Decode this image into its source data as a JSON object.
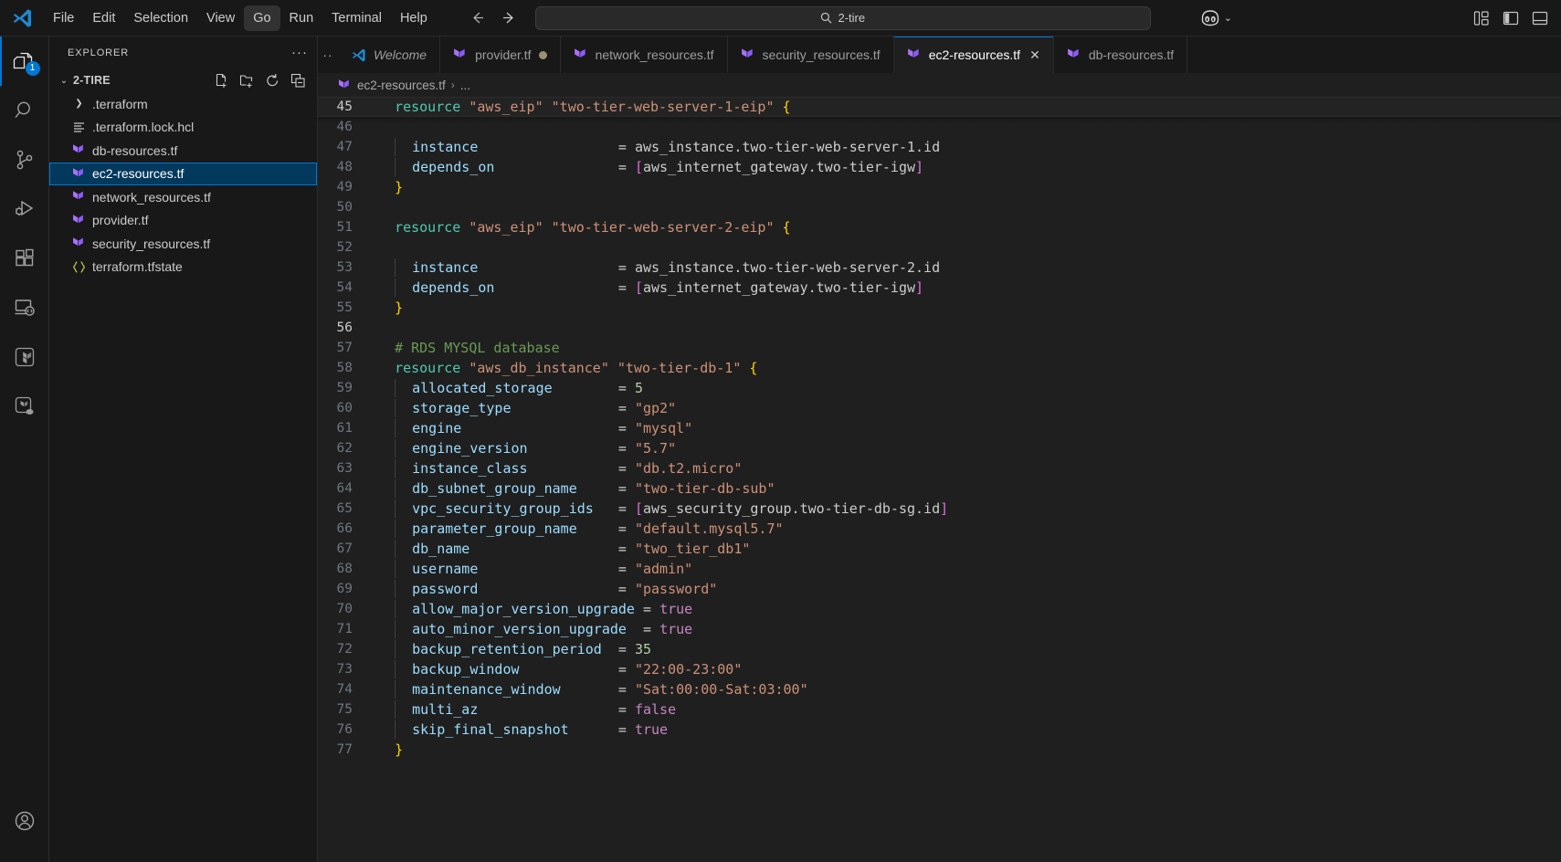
{
  "titlebar": {
    "logo_icon": "vscode-logo-icon",
    "menus": [
      {
        "label": "File",
        "active": false
      },
      {
        "label": "Edit",
        "active": false
      },
      {
        "label": "Selection",
        "active": false
      },
      {
        "label": "View",
        "active": false
      },
      {
        "label": "Go",
        "active": true
      },
      {
        "label": "Run",
        "active": false
      },
      {
        "label": "Terminal",
        "active": false
      },
      {
        "label": "Help",
        "active": false
      }
    ],
    "nav": {
      "back_icon": "arrow-left-icon",
      "forward_icon": "arrow-right-icon"
    },
    "search": {
      "value": "2-tire",
      "icon": "search-icon"
    },
    "copilot": {
      "icon": "copilot-icon",
      "chevron": "chevron-down-icon"
    },
    "layout": {
      "panel_icon": "customize-layout-icon",
      "sidebar_icon": "toggle-primary-sidebar-icon",
      "bottom_icon": "toggle-panel-icon"
    }
  },
  "activitybar": {
    "items": [
      {
        "name": "explorer",
        "icon": "files-icon",
        "badge": "1",
        "active": true
      },
      {
        "name": "search",
        "icon": "search-icon",
        "badge": "",
        "active": false
      },
      {
        "name": "source-control",
        "icon": "source-control-icon",
        "badge": "",
        "active": false
      },
      {
        "name": "run-and-debug",
        "icon": "run-debug-icon",
        "badge": "",
        "active": false
      },
      {
        "name": "extensions",
        "icon": "extensions-icon",
        "badge": "",
        "active": false
      },
      {
        "name": "remote-explorer",
        "icon": "remote-explorer-icon",
        "badge": "",
        "active": false
      },
      {
        "name": "terraform",
        "icon": "terraform-icon",
        "badge": "",
        "active": false
      },
      {
        "name": "terraform-cloud",
        "icon": "terraform-cloud-icon",
        "badge": "",
        "active": false
      }
    ],
    "account_icon": "account-icon"
  },
  "sidebar": {
    "title": "EXPLORER",
    "more_actions": "···",
    "root": {
      "label": "2-TIRE",
      "caret": "chevron-down-icon",
      "actions": [
        "new-file-icon",
        "new-folder-icon",
        "refresh-icon",
        "collapse-all-icon"
      ]
    },
    "items": [
      {
        "label": ".terraform",
        "icon": "folder-icon",
        "type": "folder",
        "selected": false
      },
      {
        "label": ".terraform.lock.hcl",
        "icon": "hcl-lock-icon",
        "type": "file",
        "selected": false
      },
      {
        "label": "db-resources.tf",
        "icon": "terraform-file-icon",
        "type": "file",
        "selected": false
      },
      {
        "label": "ec2-resources.tf",
        "icon": "terraform-file-icon",
        "type": "file",
        "selected": true
      },
      {
        "label": "network_resources.tf",
        "icon": "terraform-file-icon",
        "type": "file",
        "selected": false
      },
      {
        "label": "provider.tf",
        "icon": "terraform-file-icon",
        "type": "file",
        "selected": false
      },
      {
        "label": "security_resources.tf",
        "icon": "terraform-file-icon",
        "type": "file",
        "selected": false
      },
      {
        "label": "terraform.tfstate",
        "icon": "json-icon",
        "type": "file",
        "selected": false
      }
    ]
  },
  "editor": {
    "tabs": [
      {
        "label": "Welcome",
        "icon": "vscode-logo-icon",
        "italic": true,
        "active": false,
        "modified": false,
        "closable": false
      },
      {
        "label": "provider.tf",
        "icon": "terraform-file-icon",
        "italic": false,
        "active": false,
        "modified": true,
        "closable": false
      },
      {
        "label": "network_resources.tf",
        "icon": "terraform-file-icon",
        "italic": false,
        "active": false,
        "modified": false,
        "closable": false
      },
      {
        "label": "security_resources.tf",
        "icon": "terraform-file-icon",
        "italic": false,
        "active": false,
        "modified": false,
        "closable": false
      },
      {
        "label": "ec2-resources.tf",
        "icon": "terraform-file-icon",
        "italic": false,
        "active": true,
        "modified": false,
        "closable": true
      },
      {
        "label": "db-resources.tf",
        "icon": "terraform-file-icon",
        "italic": false,
        "active": false,
        "modified": false,
        "closable": false
      }
    ],
    "close_label": "✕",
    "breadcrumb": {
      "icon": "terraform-file-icon",
      "file": "ec2-resources.tf",
      "separator": "›",
      "rest": "..."
    },
    "lines": [
      {
        "num": "45",
        "sticky": true,
        "tokens": [
          {
            "t": "sp",
            "v": "  "
          },
          {
            "t": "kw",
            "v": "resource"
          },
          {
            "t": "plain",
            "v": " "
          },
          {
            "t": "str",
            "v": "\"aws_eip\""
          },
          {
            "t": "plain",
            "v": " "
          },
          {
            "t": "str",
            "v": "\"two-tier-web-server-1-eip\""
          },
          {
            "t": "plain",
            "v": " "
          },
          {
            "t": "brace-y",
            "v": "{"
          }
        ]
      },
      {
        "num": "46",
        "tokens": []
      },
      {
        "num": "47",
        "guide": true,
        "tokens": [
          {
            "t": "sp",
            "v": "    "
          },
          {
            "t": "prop",
            "v": "instance"
          },
          {
            "t": "plain",
            "v": "                 = "
          },
          {
            "t": "plain",
            "v": "aws_instance.two-tier-web-server-1.id"
          }
        ]
      },
      {
        "num": "48",
        "guide": true,
        "tokens": [
          {
            "t": "sp",
            "v": "    "
          },
          {
            "t": "prop",
            "v": "depends_on"
          },
          {
            "t": "plain",
            "v": "               = "
          },
          {
            "t": "brace-p",
            "v": "["
          },
          {
            "t": "plain",
            "v": "aws_internet_gateway.two-tier-igw"
          },
          {
            "t": "brace-p",
            "v": "]"
          }
        ]
      },
      {
        "num": "49",
        "tokens": [
          {
            "t": "sp",
            "v": "  "
          },
          {
            "t": "brace-y",
            "v": "}"
          }
        ]
      },
      {
        "num": "50",
        "tokens": []
      },
      {
        "num": "51",
        "tokens": [
          {
            "t": "sp",
            "v": "  "
          },
          {
            "t": "kw",
            "v": "resource"
          },
          {
            "t": "plain",
            "v": " "
          },
          {
            "t": "str",
            "v": "\"aws_eip\""
          },
          {
            "t": "plain",
            "v": " "
          },
          {
            "t": "str",
            "v": "\"two-tier-web-server-2-eip\""
          },
          {
            "t": "plain",
            "v": " "
          },
          {
            "t": "brace-y",
            "v": "{"
          }
        ]
      },
      {
        "num": "52",
        "tokens": []
      },
      {
        "num": "53",
        "guide": true,
        "tokens": [
          {
            "t": "sp",
            "v": "    "
          },
          {
            "t": "prop",
            "v": "instance"
          },
          {
            "t": "plain",
            "v": "                 = "
          },
          {
            "t": "plain",
            "v": "aws_instance.two-tier-web-server-2.id"
          }
        ]
      },
      {
        "num": "54",
        "guide": true,
        "tokens": [
          {
            "t": "sp",
            "v": "    "
          },
          {
            "t": "prop",
            "v": "depends_on"
          },
          {
            "t": "plain",
            "v": "               = "
          },
          {
            "t": "brace-p",
            "v": "["
          },
          {
            "t": "plain",
            "v": "aws_internet_gateway.two-tier-igw"
          },
          {
            "t": "brace-p",
            "v": "]"
          }
        ]
      },
      {
        "num": "55",
        "tokens": [
          {
            "t": "sp",
            "v": "  "
          },
          {
            "t": "brace-y",
            "v": "}"
          }
        ]
      },
      {
        "num": "56",
        "current": true,
        "tokens": []
      },
      {
        "num": "57",
        "tokens": [
          {
            "t": "sp",
            "v": "  "
          },
          {
            "t": "cmt",
            "v": "# RDS MYSQL database"
          }
        ]
      },
      {
        "num": "58",
        "tokens": [
          {
            "t": "sp",
            "v": "  "
          },
          {
            "t": "kw",
            "v": "resource"
          },
          {
            "t": "plain",
            "v": " "
          },
          {
            "t": "str",
            "v": "\"aws_db_instance\""
          },
          {
            "t": "plain",
            "v": " "
          },
          {
            "t": "str",
            "v": "\"two-tier-db-1\""
          },
          {
            "t": "plain",
            "v": " "
          },
          {
            "t": "brace-y",
            "v": "{"
          }
        ]
      },
      {
        "num": "59",
        "guide": true,
        "tokens": [
          {
            "t": "sp",
            "v": "    "
          },
          {
            "t": "prop",
            "v": "allocated_storage"
          },
          {
            "t": "plain",
            "v": "        = "
          },
          {
            "t": "num",
            "v": "5"
          }
        ]
      },
      {
        "num": "60",
        "guide": true,
        "tokens": [
          {
            "t": "sp",
            "v": "    "
          },
          {
            "t": "prop",
            "v": "storage_type"
          },
          {
            "t": "plain",
            "v": "             = "
          },
          {
            "t": "str",
            "v": "\"gp2\""
          }
        ]
      },
      {
        "num": "61",
        "guide": true,
        "tokens": [
          {
            "t": "sp",
            "v": "    "
          },
          {
            "t": "prop",
            "v": "engine"
          },
          {
            "t": "plain",
            "v": "                   = "
          },
          {
            "t": "str",
            "v": "\"mysql\""
          }
        ]
      },
      {
        "num": "62",
        "guide": true,
        "tokens": [
          {
            "t": "sp",
            "v": "    "
          },
          {
            "t": "prop",
            "v": "engine_version"
          },
          {
            "t": "plain",
            "v": "           = "
          },
          {
            "t": "str",
            "v": "\"5.7\""
          }
        ]
      },
      {
        "num": "63",
        "guide": true,
        "tokens": [
          {
            "t": "sp",
            "v": "    "
          },
          {
            "t": "prop",
            "v": "instance_class"
          },
          {
            "t": "plain",
            "v": "           = "
          },
          {
            "t": "str",
            "v": "\"db.t2.micro\""
          }
        ]
      },
      {
        "num": "64",
        "guide": true,
        "tokens": [
          {
            "t": "sp",
            "v": "    "
          },
          {
            "t": "prop",
            "v": "db_subnet_group_name"
          },
          {
            "t": "plain",
            "v": "     = "
          },
          {
            "t": "str",
            "v": "\"two-tier-db-sub\""
          }
        ]
      },
      {
        "num": "65",
        "guide": true,
        "tokens": [
          {
            "t": "sp",
            "v": "    "
          },
          {
            "t": "prop",
            "v": "vpc_security_group_ids"
          },
          {
            "t": "plain",
            "v": "   = "
          },
          {
            "t": "brace-p",
            "v": "["
          },
          {
            "t": "plain",
            "v": "aws_security_group.two-tier-db-sg.id"
          },
          {
            "t": "brace-p",
            "v": "]"
          }
        ]
      },
      {
        "num": "66",
        "guide": true,
        "tokens": [
          {
            "t": "sp",
            "v": "    "
          },
          {
            "t": "prop",
            "v": "parameter_group_name"
          },
          {
            "t": "plain",
            "v": "     = "
          },
          {
            "t": "str",
            "v": "\"default.mysql5.7\""
          }
        ]
      },
      {
        "num": "67",
        "guide": true,
        "tokens": [
          {
            "t": "sp",
            "v": "    "
          },
          {
            "t": "prop",
            "v": "db_name"
          },
          {
            "t": "plain",
            "v": "                  = "
          },
          {
            "t": "str",
            "v": "\"two_tier_db1\""
          }
        ]
      },
      {
        "num": "68",
        "guide": true,
        "tokens": [
          {
            "t": "sp",
            "v": "    "
          },
          {
            "t": "prop",
            "v": "username"
          },
          {
            "t": "plain",
            "v": "                 = "
          },
          {
            "t": "str",
            "v": "\"admin\""
          }
        ]
      },
      {
        "num": "69",
        "guide": true,
        "tokens": [
          {
            "t": "sp",
            "v": "    "
          },
          {
            "t": "prop",
            "v": "password"
          },
          {
            "t": "plain",
            "v": "                 = "
          },
          {
            "t": "str",
            "v": "\"password\""
          }
        ]
      },
      {
        "num": "70",
        "guide": true,
        "tokens": [
          {
            "t": "sp",
            "v": "    "
          },
          {
            "t": "prop",
            "v": "allow_major_version_upgrade"
          },
          {
            "t": "plain",
            "v": " = "
          },
          {
            "t": "bool",
            "v": "true"
          }
        ]
      },
      {
        "num": "71",
        "guide": true,
        "tokens": [
          {
            "t": "sp",
            "v": "    "
          },
          {
            "t": "prop",
            "v": "auto_minor_version_upgrade"
          },
          {
            "t": "plain",
            "v": "  = "
          },
          {
            "t": "bool",
            "v": "true"
          }
        ]
      },
      {
        "num": "72",
        "guide": true,
        "tokens": [
          {
            "t": "sp",
            "v": "    "
          },
          {
            "t": "prop",
            "v": "backup_retention_period"
          },
          {
            "t": "plain",
            "v": "  = "
          },
          {
            "t": "num",
            "v": "35"
          }
        ]
      },
      {
        "num": "73",
        "guide": true,
        "tokens": [
          {
            "t": "sp",
            "v": "    "
          },
          {
            "t": "prop",
            "v": "backup_window"
          },
          {
            "t": "plain",
            "v": "            = "
          },
          {
            "t": "str",
            "v": "\"22:00-23:00\""
          }
        ]
      },
      {
        "num": "74",
        "guide": true,
        "tokens": [
          {
            "t": "sp",
            "v": "    "
          },
          {
            "t": "prop",
            "v": "maintenance_window"
          },
          {
            "t": "plain",
            "v": "       = "
          },
          {
            "t": "str",
            "v": "\"Sat:00:00-Sat:03:00\""
          }
        ]
      },
      {
        "num": "75",
        "guide": true,
        "tokens": [
          {
            "t": "sp",
            "v": "    "
          },
          {
            "t": "prop",
            "v": "multi_az"
          },
          {
            "t": "plain",
            "v": "                 = "
          },
          {
            "t": "bool",
            "v": "false"
          }
        ]
      },
      {
        "num": "76",
        "guide": true,
        "tokens": [
          {
            "t": "sp",
            "v": "    "
          },
          {
            "t": "prop",
            "v": "skip_final_snapshot"
          },
          {
            "t": "plain",
            "v": "      = "
          },
          {
            "t": "bool",
            "v": "true"
          }
        ]
      },
      {
        "num": "77",
        "tokens": [
          {
            "t": "sp",
            "v": "  "
          },
          {
            "t": "brace-y",
            "v": "}"
          }
        ]
      }
    ]
  },
  "colors": {
    "accent": "#0078d4",
    "editor_bg": "#1f1f1f",
    "chrome_bg": "#181818",
    "selection_bg": "#04395e",
    "keyword": "#4ec9b0",
    "string": "#ce9178",
    "comment": "#6a9955",
    "number": "#b5cea8",
    "boolean": "#c586c0",
    "property": "#9cdcfe",
    "brace_yellow": "#ffd700",
    "brace_purple": "#da70d6",
    "terraform_purple": "#a970ff"
  }
}
